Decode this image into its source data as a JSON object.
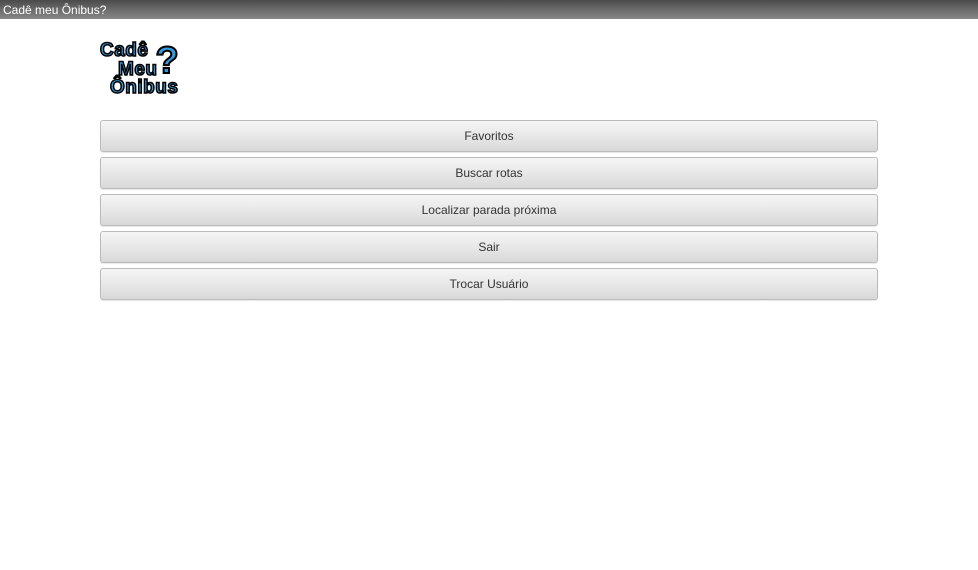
{
  "titleBar": {
    "title": "Cadê meu Ônibus?"
  },
  "logo": {
    "word1": "Cadê",
    "word2": "Meu",
    "word3": "Ônibus",
    "mark": "?"
  },
  "buttons": {
    "favoritos": "Favoritos",
    "buscarRotas": "Buscar rotas",
    "localizarParada": "Localizar parada próxima",
    "sair": "Sair",
    "trocarUsuario": "Trocar Usuário"
  }
}
